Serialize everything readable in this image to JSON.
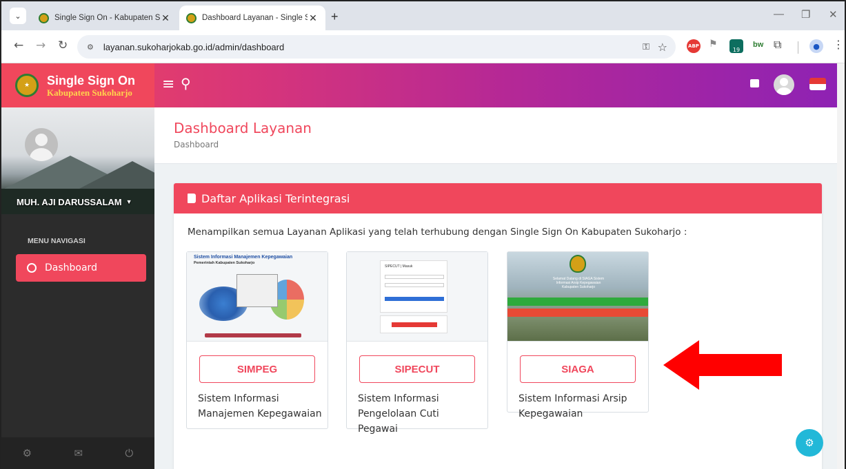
{
  "browser": {
    "tabs": [
      {
        "title": "Single Sign On - Kabupaten Suk",
        "active": false
      },
      {
        "title": "Dashboard Layanan - Single Sig",
        "active": true
      }
    ],
    "url": "layanan.sukoharjokab.go.id/admin/dashboard"
  },
  "header": {
    "brand_title": "Single Sign On",
    "brand_subtitle": "Kabupaten Sukoharjo"
  },
  "sidebar": {
    "user_name": "MUH. AJI DARUSSALAM",
    "menu_heading": "MENU NAVIGASI",
    "items": [
      {
        "label": "Dashboard",
        "active": true
      }
    ]
  },
  "page": {
    "title": "Dashboard Layanan",
    "breadcrumb": "Dashboard"
  },
  "card": {
    "title": "Daftar Aplikasi Terintegrasi",
    "description": "Menampilkan semua Layanan Aplikasi yang telah terhubung dengan Single Sign On Kabupaten Sukoharjo :",
    "apps": [
      {
        "name": "SIMPEG",
        "description": "Sistem Informasi Manajemen Kepegawaian",
        "thumb_title": "Sistem Informasi Manajemen Kepegawaian",
        "thumb_subtitle": "Pemerintah Kabupaten Sukoharjo"
      },
      {
        "name": "SIPECUT",
        "description": "Sistem Informasi Pengelolaan Cuti Pegawai",
        "thumb_title": "SIPECUT | Masuk"
      },
      {
        "name": "SIAGA",
        "description": "Sistem Informasi Arsip Kepegawaian",
        "thumb_title": "Selamat Datang di SIAGA Sistem Informasi Arsip Kepegawaian Kabupaten Sukoharjo"
      }
    ]
  },
  "colors": {
    "accent": "#f0475c",
    "header_gradient_end": "#8d22b4",
    "sidebar_bg": "#2c2c2c",
    "fab": "#22b8d8",
    "annotation_arrow": "#ff0000"
  }
}
